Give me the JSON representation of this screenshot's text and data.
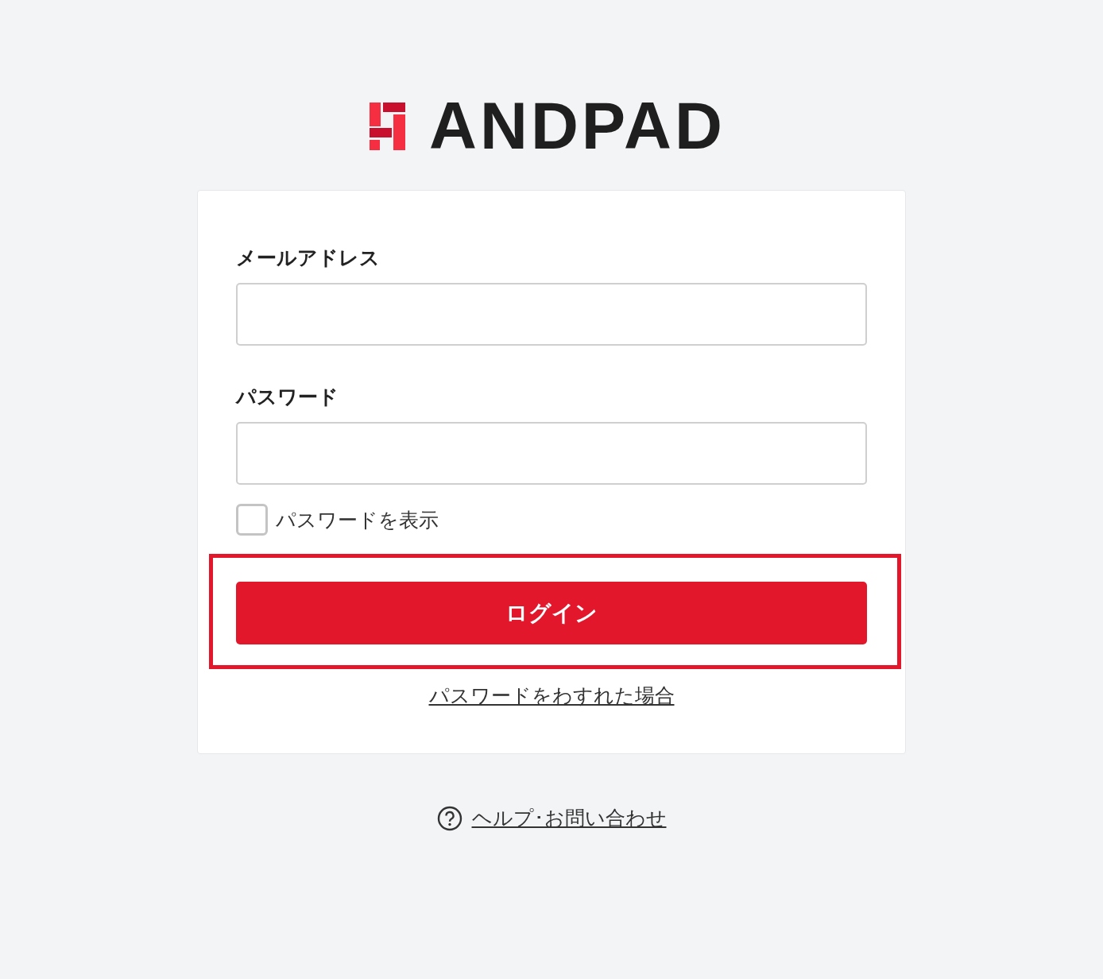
{
  "logo": {
    "text": "ANDPAD"
  },
  "form": {
    "fields": [
      {
        "label": "メールアドレス"
      },
      {
        "label": "パスワード"
      }
    ],
    "show_password": {
      "label": "パスワードを表示",
      "checked": false
    },
    "login_button": {
      "label": "ログイン",
      "highlighted": true
    },
    "forgot_link": "パスワードをわすれた場合"
  },
  "help_link": "ヘルプ･お問い合わせ"
}
